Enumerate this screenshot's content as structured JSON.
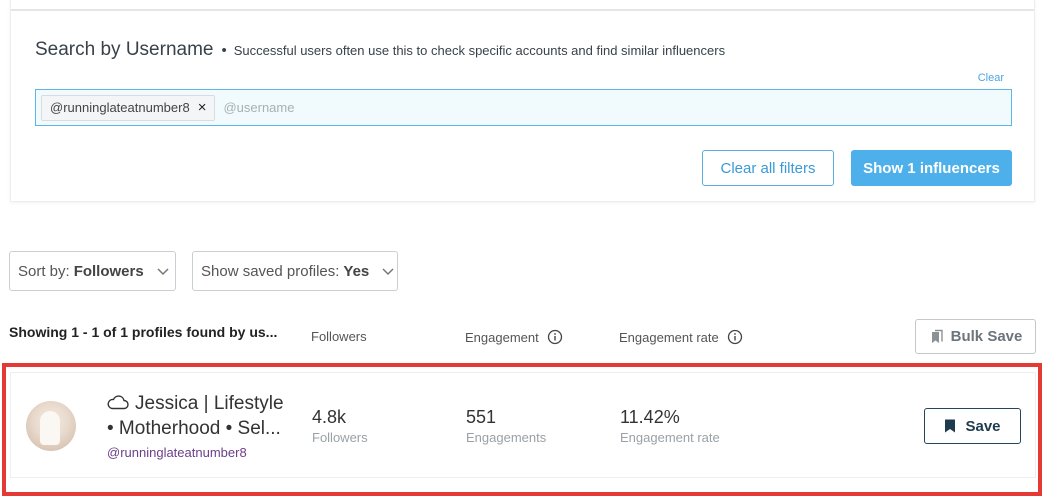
{
  "search": {
    "title": "Search by Username",
    "dot": "•",
    "hint": "Successful users often use this to check specific accounts and find similar influencers",
    "clear": "Clear",
    "chip": "@runninglateatnumber8",
    "chip_remove": "×",
    "placeholder": "@username",
    "clear_all": "Clear all filters",
    "show": "Show 1 influencers"
  },
  "sort": {
    "label": "Sort by:",
    "value": "Followers"
  },
  "saved": {
    "label": "Show saved profiles:",
    "value": "Yes"
  },
  "results": {
    "showing": "Showing 1 - 1 of 1 profiles found by us...",
    "col_followers": "Followers",
    "col_engagement": "Engagement",
    "col_rate": "Engagement rate",
    "bulk_save": "Bulk Save"
  },
  "profile": {
    "name": "Jessica | Lifestyle • Motherhood • Sel...",
    "handle": "@runninglateatnumber8",
    "followers": "4.8k",
    "followers_label": "Followers",
    "engagements": "551",
    "engagements_label": "Engagements",
    "rate": "11.42%",
    "rate_label": "Engagement rate",
    "save": "Save"
  },
  "colors": {
    "accent": "#4db0ea",
    "highlight": "#e53935",
    "handle": "#6b3f8a"
  }
}
